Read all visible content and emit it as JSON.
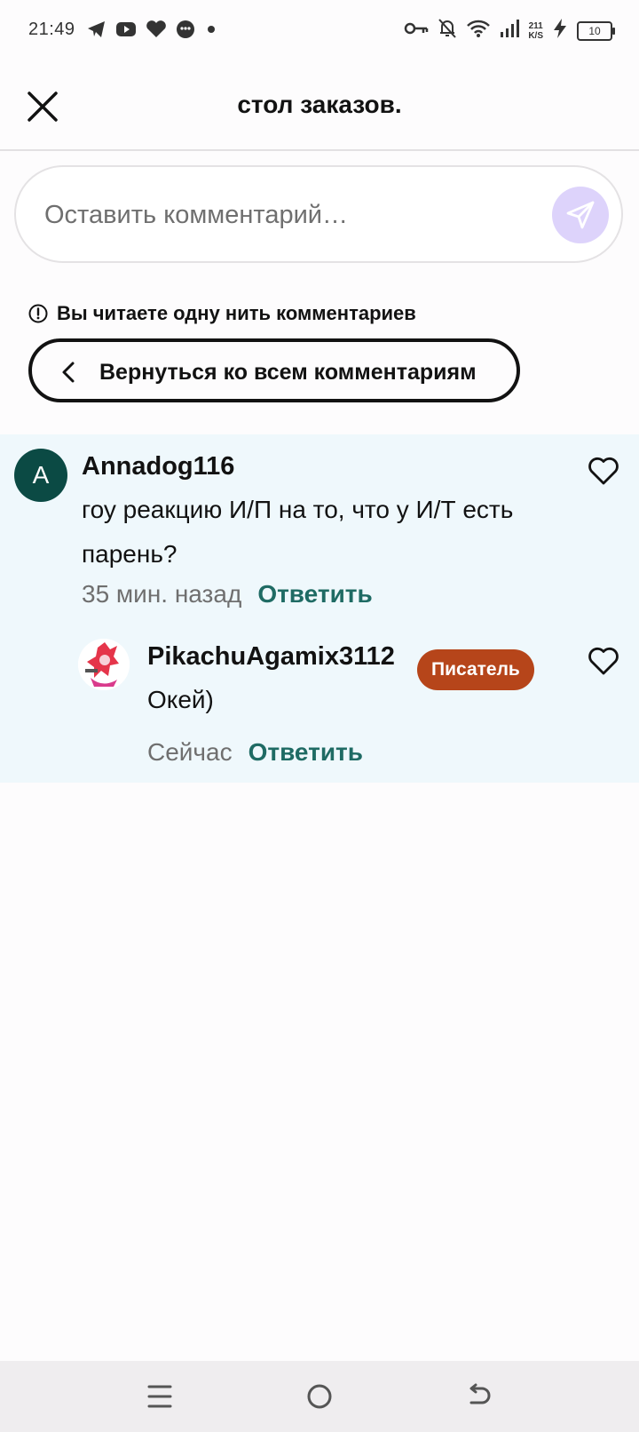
{
  "status_bar": {
    "time": "21:49",
    "net_speed_value": "211",
    "net_speed_unit": "K/S",
    "battery": "10"
  },
  "header": {
    "title": "стол заказов."
  },
  "comment_input": {
    "placeholder": "Оставить комментарий…"
  },
  "thread_notice": "Вы читаете одну нить комментариев",
  "back_button_label": "Вернуться ко всем комментариям",
  "comments": [
    {
      "avatar_letter": "A",
      "username": "Annadog116",
      "text_line1": "гоу реакцию И/П на то, что у И/Т есть",
      "text_line2": "парень?",
      "time": "35 мин. назад",
      "reply_label": "Ответить"
    },
    {
      "username": "PikachuAgamix3112",
      "badge": "Писатель",
      "text": "Окей)",
      "time": "Сейчас",
      "reply_label": "Ответить"
    }
  ],
  "colors": {
    "accent_teal": "#1f6b64",
    "badge": "#b6451a",
    "send_button": "#ddd3fb",
    "thread_bg": "#eff8fc"
  }
}
